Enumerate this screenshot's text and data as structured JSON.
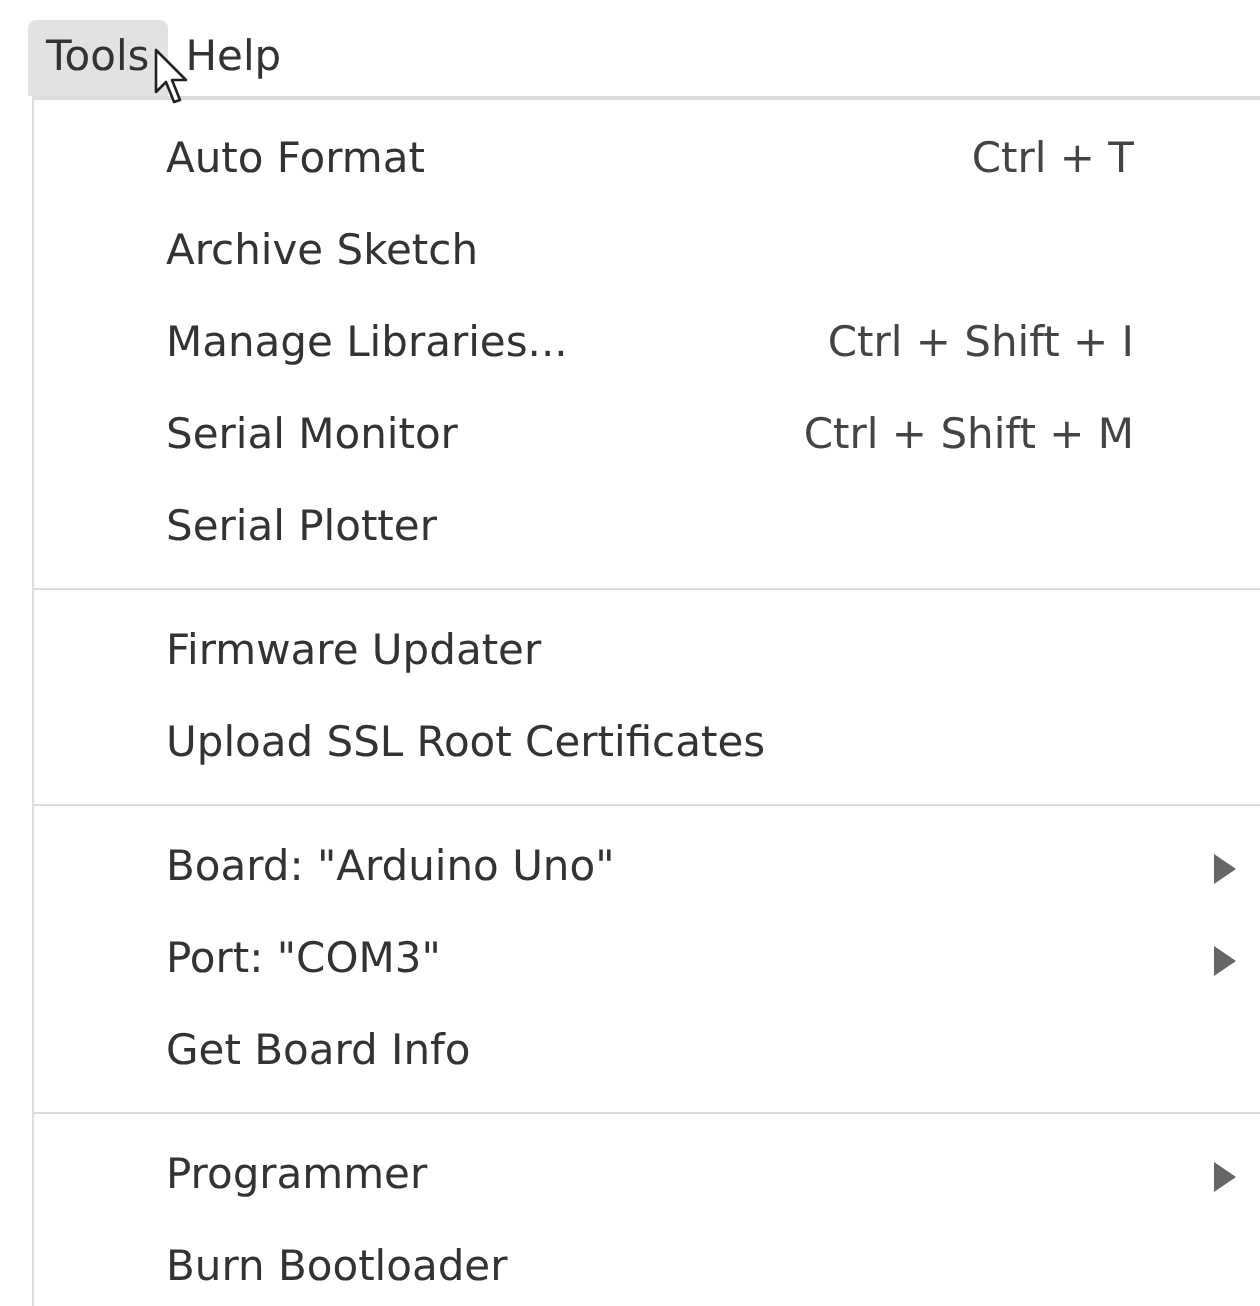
{
  "menubar": [
    {
      "label": "Tools",
      "selected": true
    },
    {
      "label": "Help",
      "selected": false
    }
  ],
  "menu": {
    "groups": [
      {
        "items": [
          {
            "label": "Auto Format",
            "shortcut": "Ctrl + T",
            "submenu": false
          },
          {
            "label": "Archive Sketch",
            "submenu": false
          },
          {
            "label": "Manage Libraries...",
            "shortcut": "Ctrl + Shift + I",
            "submenu": false
          },
          {
            "label": "Serial Monitor",
            "shortcut": "Ctrl + Shift + M",
            "submenu": false
          },
          {
            "label": "Serial Plotter",
            "submenu": false
          }
        ]
      },
      {
        "items": [
          {
            "label": "Firmware Updater",
            "submenu": false
          },
          {
            "label": "Upload SSL Root Certificates",
            "submenu": false
          }
        ]
      },
      {
        "items": [
          {
            "label": "Board: \"Arduino Uno\"",
            "submenu": true
          },
          {
            "label": "Port: \"COM3\"",
            "submenu": true
          },
          {
            "label": "Get Board Info",
            "submenu": false
          }
        ]
      },
      {
        "items": [
          {
            "label": "Programmer",
            "submenu": true
          },
          {
            "label": "Burn Bootloader",
            "submenu": false
          }
        ]
      }
    ]
  }
}
